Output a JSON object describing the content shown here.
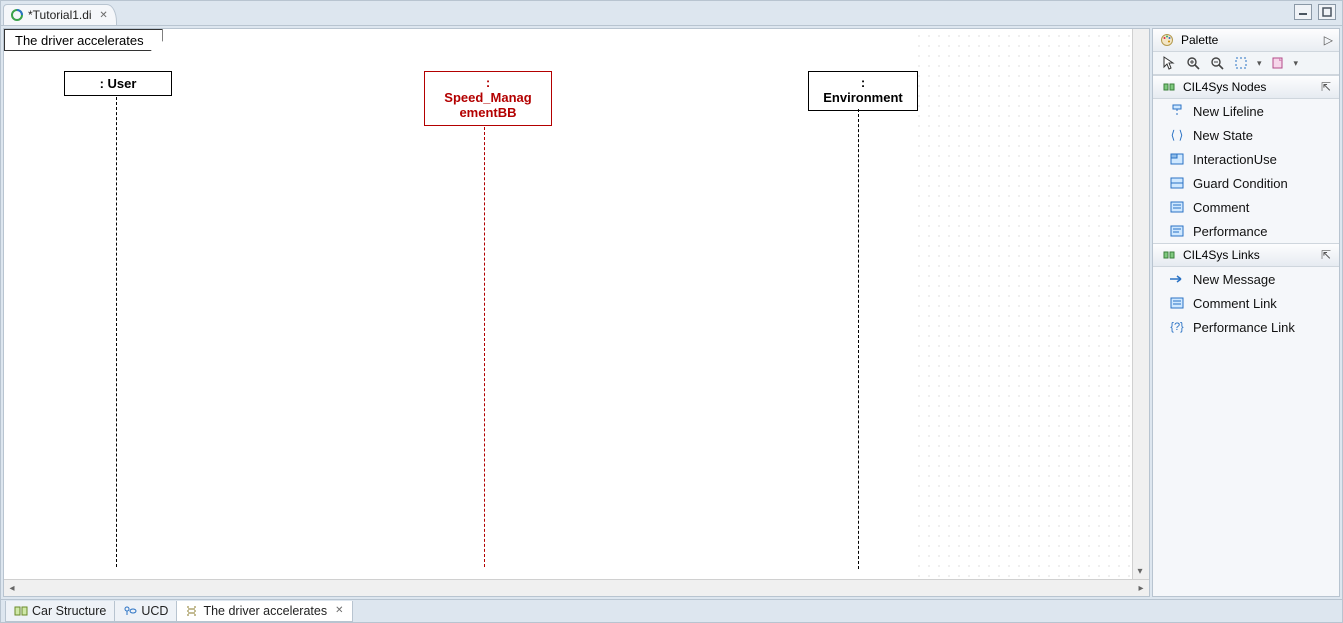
{
  "editor_tab": {
    "title": "*Tutorial1.di"
  },
  "diagram": {
    "title": "The driver accelerates",
    "lifelines": {
      "user": {
        "label": ": User"
      },
      "speed": {
        "label_line1": ":",
        "label_line2": "Speed_Manag",
        "label_line3": "ementBB"
      },
      "env": {
        "label_line1": ":",
        "label_line2": "Environment"
      }
    }
  },
  "palette": {
    "title": "Palette",
    "drawers": {
      "nodes": {
        "title": "CIL4Sys Nodes",
        "items": {
          "new_lifeline": "New Lifeline",
          "new_state": "New State",
          "interaction_use": "InteractionUse",
          "guard_condition": "Guard Condition",
          "comment": "Comment",
          "performance": "Performance"
        }
      },
      "links": {
        "title": "CIL4Sys Links",
        "items": {
          "new_message": "New Message",
          "comment_link": "Comment Link",
          "performance_link": "Performance Link"
        }
      }
    }
  },
  "bottom_tabs": {
    "car_structure": "Car Structure",
    "ucd": "UCD",
    "driver_accel": "The driver accelerates"
  }
}
